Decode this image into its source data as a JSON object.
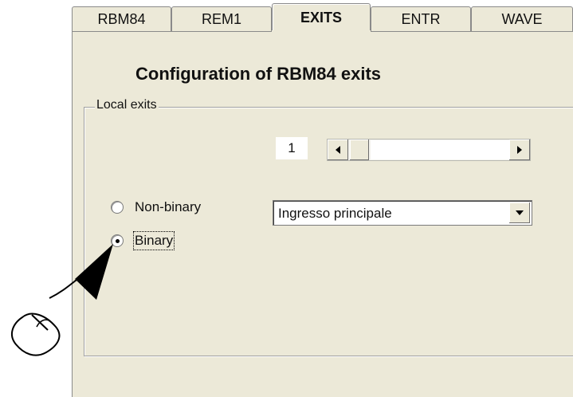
{
  "tabs": [
    {
      "label": "RBM84"
    },
    {
      "label": "REM1"
    },
    {
      "label": "EXITS"
    },
    {
      "label": "ENTR"
    },
    {
      "label": "WAVE"
    }
  ],
  "active_tab": "EXITS",
  "title": "Configuration of RBM84 exits",
  "group": {
    "legend": "Local exits"
  },
  "exit_selector": {
    "value": "1"
  },
  "radios": [
    {
      "label": "Non-binary",
      "selected": false
    },
    {
      "label": "Binary",
      "selected": true
    }
  ],
  "combo": {
    "value": "Ingresso principale"
  },
  "icons": {
    "scroll_left": "left-arrow-icon",
    "scroll_right": "right-arrow-icon",
    "dropdown": "chevron-down-icon",
    "cursor": "arrow-cursor-icon",
    "mouse": "mouse-icon"
  },
  "colors": {
    "panel": "#ece9d8",
    "border": "#8a8a8a",
    "text": "#111111"
  }
}
